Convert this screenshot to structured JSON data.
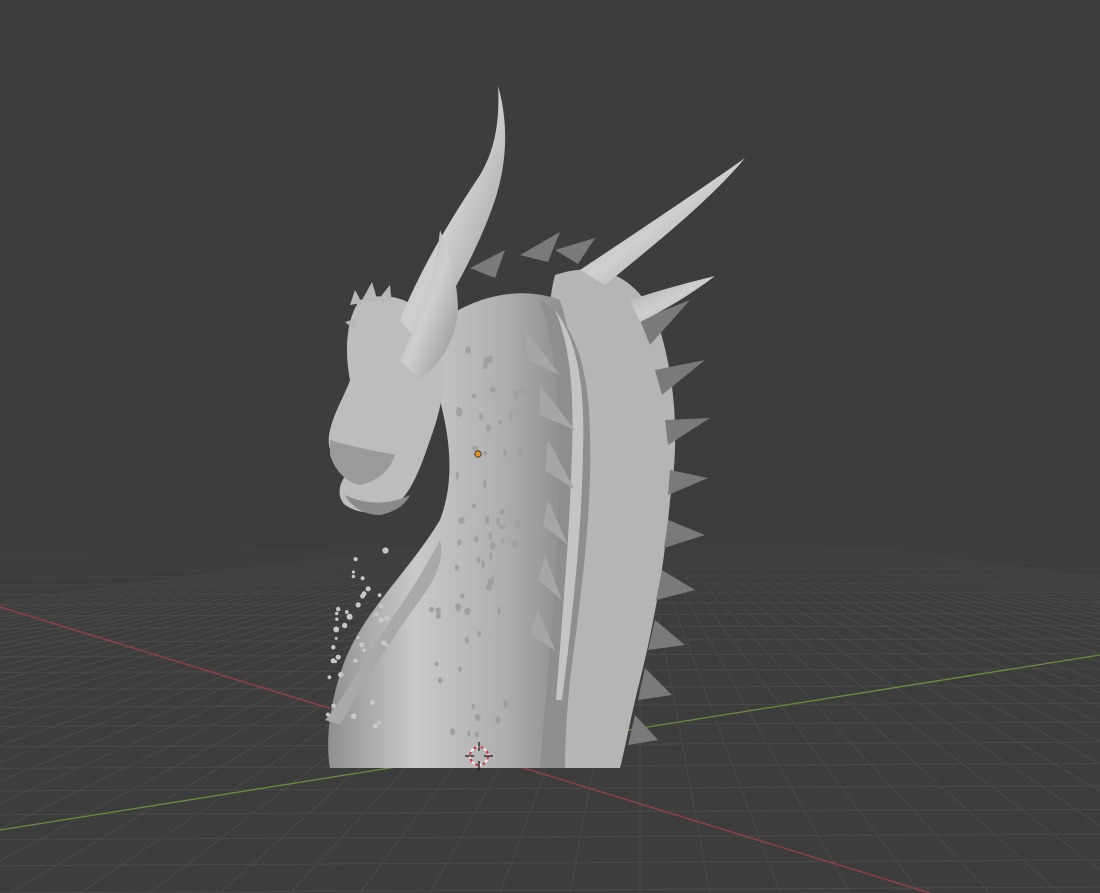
{
  "viewport": {
    "background_color": "#3d3d3d",
    "grid_line_color": "#4a4a4a",
    "x_axis_color": "#9c3f47",
    "y_axis_color": "#6a8f3c"
  },
  "scene": {
    "object": {
      "icon": "dragon-head-sculpt",
      "base_color": "#b5b5b5",
      "highlight_color": "#d6d6d6",
      "shadow_color": "#7a7a7a",
      "selected": false
    },
    "origin_point": {
      "icon": "object-origin-dot",
      "color": "#e6932b"
    },
    "cursor_3d": {
      "icon": "3d-cursor-crosshair",
      "ring_color_a": "#d23c3c",
      "ring_color_b": "#f0f0f0"
    }
  }
}
